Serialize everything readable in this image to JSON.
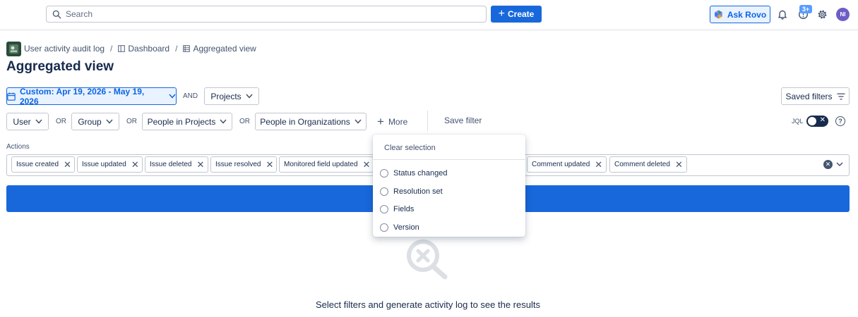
{
  "header": {
    "search_placeholder": "Search",
    "create_label": "Create",
    "ask_rovo_label": "Ask Rovo",
    "notifications_badge": "3+",
    "avatar_initials": "NI"
  },
  "breadcrumb": {
    "items": [
      "User activity audit log",
      "Dashboard",
      "Aggregated view"
    ],
    "separator": "/"
  },
  "page": {
    "title": "Aggregated view"
  },
  "filters": {
    "date_range": "Custom: Apr 19, 2026 - May 19, 2026",
    "and_label": "AND",
    "projects_label": "Projects",
    "saved_filters_label": "Saved filters",
    "user_label": "User",
    "or_label": "OR",
    "group_label": "Group",
    "people_in_projects_label": "People in Projects",
    "people_in_orgs_label": "People in Organizations",
    "more_label": "More",
    "save_filter_label": "Save filter",
    "jql_label": "JQL"
  },
  "actions": {
    "label": "Actions",
    "chips": [
      "Issue created",
      "Issue updated",
      "Issue deleted",
      "Issue resolved",
      "Monitored field updated",
      "Comment updated",
      "Comment deleted"
    ]
  },
  "dropdown": {
    "clear_label": "Clear selection",
    "items": [
      "Status changed",
      "Resolution set",
      "Fields",
      "Version"
    ]
  },
  "empty_state": {
    "message": "Select filters and generate activity log to see the results"
  },
  "colors": {
    "primary": "#1868db",
    "text": "#172b4d",
    "subtle": "#44546f",
    "avatar": "#6e5dc6"
  }
}
